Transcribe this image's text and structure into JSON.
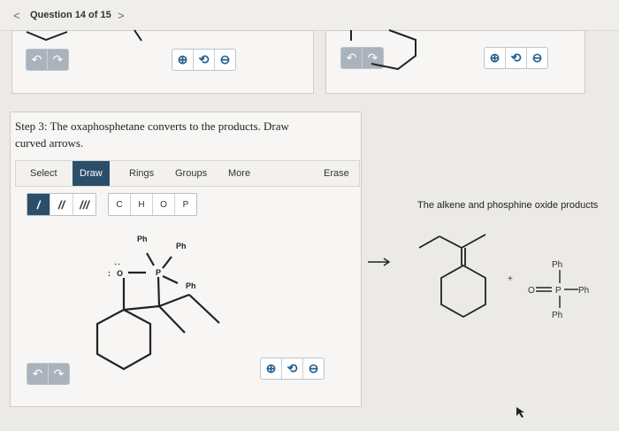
{
  "header": {
    "prev": "<",
    "title": "Question 14 of 15",
    "next": ">"
  },
  "step": {
    "text": "Step 3: The oxaphosphetane converts to the products. Draw curved arrows."
  },
  "toolbar": {
    "tabs": [
      "Select",
      "Draw",
      "Rings",
      "Groups",
      "More"
    ],
    "active_tab": "Draw",
    "erase": "Erase"
  },
  "bonds": [
    "/",
    "//",
    "///"
  ],
  "atoms": [
    "C",
    "H",
    "O",
    "P"
  ],
  "zoom_icons": {
    "in": "⊕",
    "reset": "⟲",
    "out": "⊖"
  },
  "undo_icons": {
    "undo": "↶",
    "redo": "↷"
  },
  "molecule_labels": {
    "ph1": "Ph",
    "ph2": "Ph",
    "ph3": "Ph",
    "oxygen": "O",
    "phosphorus": "P",
    "lone_pair": ":"
  },
  "products": {
    "caption": "The alkene and phosphine oxide products",
    "plus": "+",
    "ph_top": "Ph",
    "ph_right": "Ph",
    "ph_bottom": "Ph",
    "o": "O",
    "p": "P"
  },
  "colors": {
    "accent": "#2b4f6b",
    "zoom_icon": "#225f8f"
  }
}
